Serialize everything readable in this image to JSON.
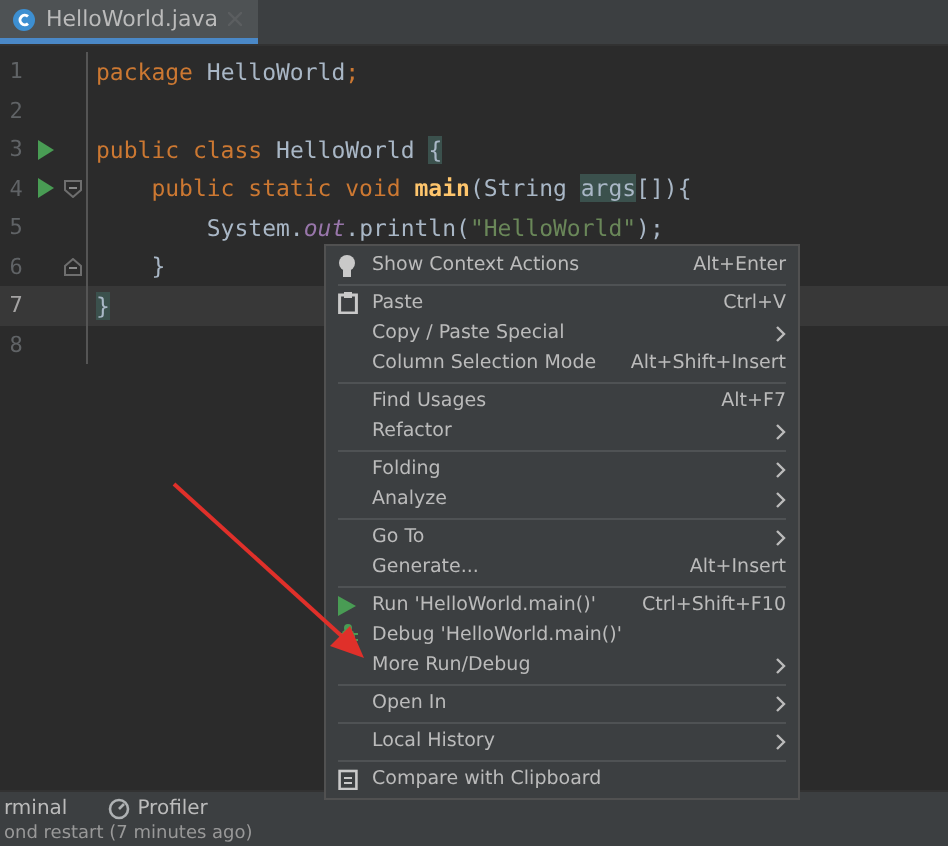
{
  "tabs": [
    {
      "label": "HelloWorld.java",
      "selected": true
    }
  ],
  "editor": {
    "lines": [
      {
        "number": "1",
        "run": false,
        "current": false,
        "kind": "plain",
        "tokens": [
          {
            "kind": "keyword",
            "text": "package "
          },
          {
            "kind": "plain",
            "text": "HelloWorld"
          },
          {
            "kind": "keyword",
            "text": ";"
          }
        ]
      },
      {
        "number": "2",
        "run": false,
        "current": false,
        "kind": "plain"
      },
      {
        "number": "3",
        "run": true,
        "current": false,
        "kind": "plain",
        "tokens": [
          {
            "kind": "keyword",
            "text": "public class "
          },
          {
            "kind": "plain",
            "text": "HelloWorld "
          },
          {
            "kind": "brace",
            "text": "{"
          }
        ]
      },
      {
        "number": "4",
        "run": true,
        "current": false,
        "kind": "fold-start",
        "tokens": [
          {
            "kind": "keyword",
            "text": "    public static void "
          },
          {
            "kind": "method",
            "text": "main"
          },
          {
            "kind": "plain",
            "text": "(String "
          },
          {
            "kind": "param",
            "text": "args"
          },
          {
            "kind": "plain",
            "text": "[]){"
          }
        ]
      },
      {
        "number": "5",
        "run": false,
        "current": false,
        "kind": "plain",
        "tokens": [
          {
            "kind": "plain",
            "text": "        System."
          },
          {
            "kind": "field",
            "text": "out"
          },
          {
            "kind": "plain",
            "text": ".println("
          },
          {
            "kind": "string",
            "text": "\"HelloWorld\""
          },
          {
            "kind": "plain",
            "text": ");"
          }
        ]
      },
      {
        "number": "6",
        "run": false,
        "current": false,
        "kind": "fold-end",
        "tokens": [
          {
            "kind": "plain",
            "text": "    }"
          }
        ]
      },
      {
        "number": "7",
        "run": false,
        "current": true,
        "kind": "plain",
        "tokens": [
          {
            "kind": "brace",
            "text": "}"
          }
        ]
      },
      {
        "number": "8",
        "run": false,
        "current": false,
        "kind": "plain"
      }
    ]
  },
  "context_menu": {
    "groups": [
      [
        {
          "label": "Show Context Actions",
          "shortcut": "Alt+Enter",
          "submenu": false,
          "kind": "bulb"
        }
      ],
      [
        {
          "label": "Paste",
          "shortcut": "Ctrl+V",
          "submenu": false,
          "kind": "paste"
        },
        {
          "label": "Copy / Paste Special",
          "submenu": true,
          "kind": "plain"
        },
        {
          "label": "Column Selection Mode",
          "shortcut": "Alt+Shift+Insert",
          "submenu": false,
          "kind": "plain"
        }
      ],
      [
        {
          "label": "Find Usages",
          "shortcut": "Alt+F7",
          "submenu": false,
          "kind": "plain"
        },
        {
          "label": "Refactor",
          "submenu": true,
          "kind": "plain"
        }
      ],
      [
        {
          "label": "Folding",
          "submenu": true,
          "kind": "plain"
        },
        {
          "label": "Analyze",
          "submenu": true,
          "kind": "plain"
        }
      ],
      [
        {
          "label": "Go To",
          "submenu": true,
          "kind": "plain"
        },
        {
          "label": "Generate...",
          "shortcut": "Alt+Insert",
          "submenu": false,
          "kind": "plain"
        }
      ],
      [
        {
          "label": "Run 'HelloWorld.main()'",
          "shortcut": "Ctrl+Shift+F10",
          "submenu": false,
          "kind": "run"
        },
        {
          "label": "Debug 'HelloWorld.main()'",
          "submenu": false,
          "kind": "debug"
        },
        {
          "label": "More Run/Debug",
          "submenu": true,
          "kind": "plain"
        }
      ],
      [
        {
          "label": "Open In",
          "submenu": true,
          "kind": "plain"
        }
      ],
      [
        {
          "label": "Local History",
          "submenu": true,
          "kind": "plain"
        }
      ],
      [
        {
          "label": "Compare with Clipboard",
          "submenu": false,
          "kind": "compare"
        }
      ]
    ]
  },
  "tool_windows": [
    {
      "label": "rminal",
      "kind": "plain"
    },
    {
      "label": "Profiler",
      "kind": "profiler"
    }
  ],
  "status_bar": {
    "text": "ond restart (7 minutes ago)"
  }
}
